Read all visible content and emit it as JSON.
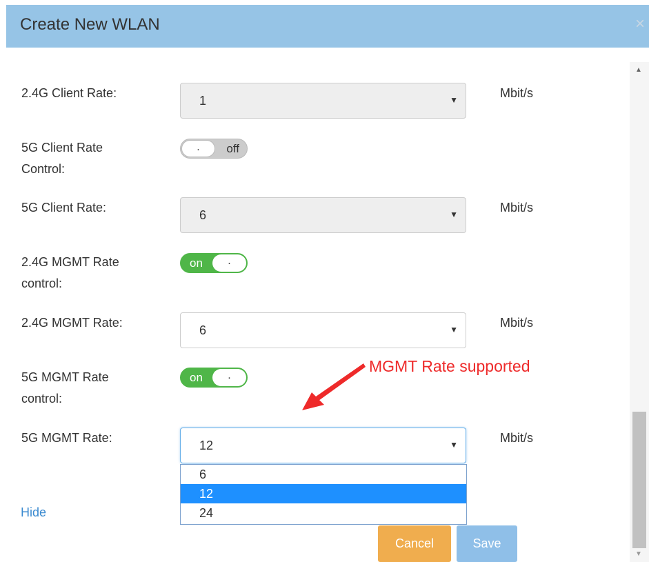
{
  "dialog": {
    "title": "Create New WLAN",
    "close_icon": "×"
  },
  "fields": {
    "client_rate_24": {
      "label": "2.4G Client Rate:",
      "value": "1",
      "unit": "Mbit/s"
    },
    "client_rate_control_5g": {
      "label_line1": "5G Client Rate",
      "label_line2": "Control:",
      "state_text": "off",
      "knob": "."
    },
    "client_rate_5g": {
      "label": "5G Client Rate:",
      "value": "6",
      "unit": "Mbit/s"
    },
    "mgmt_rate_control_24": {
      "label_line1": "2.4G MGMT Rate",
      "label_line2": "control:",
      "state_text": "on",
      "knob": "."
    },
    "mgmt_rate_24": {
      "label": "2.4G MGMT Rate:",
      "value": "6",
      "unit": "Mbit/s"
    },
    "mgmt_rate_control_5g": {
      "label_line1": "5G MGMT Rate",
      "label_line2": "control:",
      "state_text": "on",
      "knob": "."
    },
    "mgmt_rate_5g": {
      "label": "5G MGMT Rate:",
      "value": "12",
      "unit": "Mbit/s",
      "options": [
        "6",
        "12",
        "24"
      ]
    }
  },
  "caret": "▼",
  "annotation": "MGMT Rate supported",
  "links": {
    "hide": "Hide"
  },
  "buttons": {
    "cancel": "Cancel",
    "save": "Save"
  },
  "colors": {
    "header": "#96c4e6",
    "toggle_on": "#4fb648",
    "cancel": "#f0ad4e",
    "save": "#8fbfe8",
    "annotation": "#ee2a2a",
    "selected_option": "#1e90ff"
  }
}
